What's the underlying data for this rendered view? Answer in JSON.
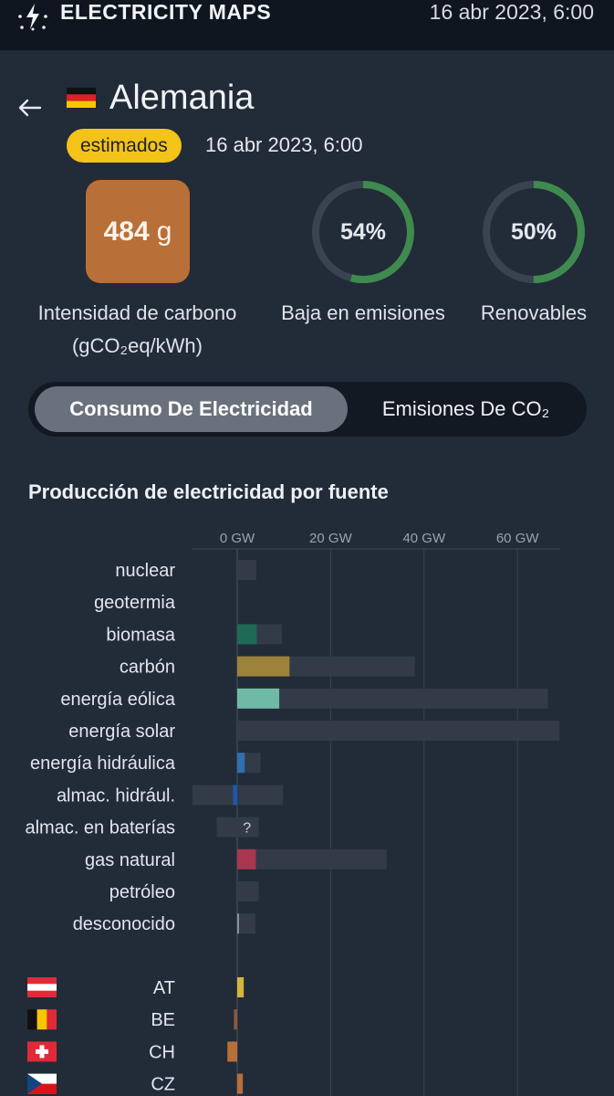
{
  "app": {
    "name": "ELECTRICITY MAPS",
    "datetime": "16 abr 2023, 6:00"
  },
  "zone": {
    "name": "Alemania",
    "badge": "estimados",
    "datetime": "16 abr 2023, 6:00"
  },
  "metrics": {
    "carbon": {
      "value": "484",
      "unit": "g",
      "label_line1": "Intensidad de carbono",
      "label_line2": "(gCO₂eq/kWh)"
    },
    "low_carbon": {
      "value": "54%",
      "fraction": 0.54,
      "label": "Baja en emisiones"
    },
    "renewable": {
      "value": "50%",
      "fraction": 0.5,
      "label": "Renovables"
    }
  },
  "toggle": {
    "active": "Consumo De Electricidad",
    "inactive": "Emisiones De CO₂"
  },
  "section_title": "Producción de electricidad por fuente",
  "colors": {
    "ring_fill": "#3f8a4e",
    "ring_track": "#3a4350",
    "capacity": "#323b47",
    "carbon_box": "#b86f38",
    "badge": "#f3c319"
  },
  "chart_data": {
    "type": "bar",
    "axis": {
      "ticks": [
        0,
        20,
        40,
        60
      ],
      "tick_labels": [
        "0 GW",
        "20 GW",
        "40 GW",
        "60 GW"
      ],
      "min": -10,
      "max": 69,
      "grid": true
    },
    "sources": [
      {
        "label": "nuclear",
        "value": 0,
        "capacity_min": 0,
        "capacity_max": 4.1,
        "color": "#323b47"
      },
      {
        "label": "geotermia",
        "value": 0,
        "capacity_min": 0,
        "capacity_max": 0,
        "color": "#323b47"
      },
      {
        "label": "biomasa",
        "value": 4.2,
        "capacity_min": 0,
        "capacity_max": 9.6,
        "color": "#1e6a57"
      },
      {
        "label": "carbón",
        "value": 11.2,
        "capacity_min": 0,
        "capacity_max": 38,
        "color": "#9d823a"
      },
      {
        "label": "energía eólica",
        "value": 9.0,
        "capacity_min": 0,
        "capacity_max": 66.5,
        "color": "#6fbaa6"
      },
      {
        "label": "energía solar",
        "value": 0,
        "capacity_min": 0,
        "capacity_max": 69,
        "color": "#323b47"
      },
      {
        "label": "energía hidráulica",
        "value": 1.6,
        "capacity_min": 0,
        "capacity_max": 5.0,
        "color": "#2f6fb0"
      },
      {
        "label": "almac. hidrául.",
        "value": -0.9,
        "capacity_min": -9.6,
        "capacity_max": 9.8,
        "color": "#2058a7"
      },
      {
        "label": "almac. en baterías",
        "value": 0,
        "capacity_min": -4.4,
        "capacity_max": 4.6,
        "color": "#323b47",
        "unknown_mark": "?"
      },
      {
        "label": "gas natural",
        "value": 4.0,
        "capacity_min": 0,
        "capacity_max": 32,
        "color": "#a8374f"
      },
      {
        "label": "petróleo",
        "value": 0,
        "capacity_min": 0,
        "capacity_max": 4.6,
        "color": "#323b47"
      },
      {
        "label": "desconocido",
        "value": 0.2,
        "capacity_min": 0,
        "capacity_max": 3.9,
        "color": "#8b9099"
      }
    ],
    "exchanges": [
      {
        "label": "AT",
        "value": 1.4,
        "color": "#d4b63a",
        "flag": "austria-flag"
      },
      {
        "label": "BE",
        "value": -0.7,
        "color": "#8a5a3e",
        "flag": "belgium-flag"
      },
      {
        "label": "CH",
        "value": -2.1,
        "color": "#b86f38",
        "flag": "switzerland-flag"
      },
      {
        "label": "CZ",
        "value": 1.2,
        "color": "#b86f38",
        "flag": "czech-flag"
      }
    ]
  }
}
